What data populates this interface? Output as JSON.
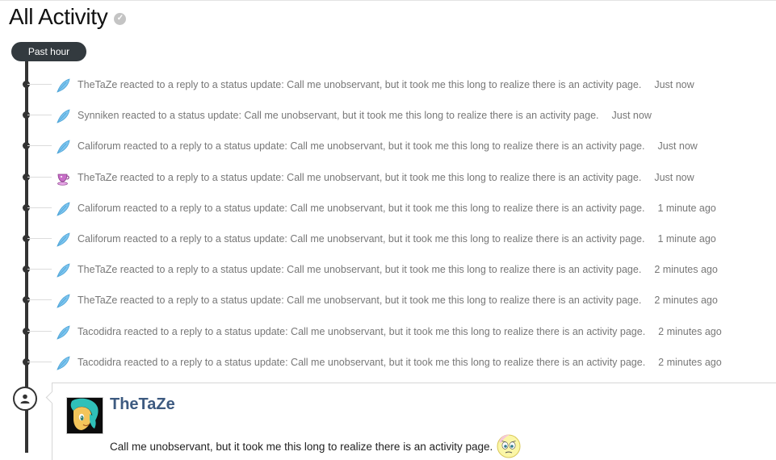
{
  "page": {
    "title": "All Activity"
  },
  "timeline": {
    "period_label": "Past hour"
  },
  "activities": [
    {
      "text": "TheTaZe reacted to a reply to a status update: Call me unobservant, but it took me this long to realize there is an activity page.",
      "time": "Just now",
      "reaction": "feather"
    },
    {
      "text": "Synniken reacted to a status update: Call me unobservant, but it took me this long to realize there is an activity page.",
      "time": "Just now",
      "reaction": "feather"
    },
    {
      "text": "Califorum reacted to a reply to a status update: Call me unobservant, but it took me this long to realize there is an activity page.",
      "time": "Just now",
      "reaction": "feather"
    },
    {
      "text": "TheTaZe reacted to a reply to a status update: Call me unobservant, but it took me this long to realize there is an activity page.",
      "time": "Just now",
      "reaction": "teacup"
    },
    {
      "text": "Califorum reacted to a reply to a status update: Call me unobservant, but it took me this long to realize there is an activity page.",
      "time": "1 minute ago",
      "reaction": "feather"
    },
    {
      "text": "Califorum reacted to a reply to a status update: Call me unobservant, but it took me this long to realize there is an activity page.",
      "time": "1 minute ago",
      "reaction": "feather"
    },
    {
      "text": "TheTaZe reacted to a reply to a status update: Call me unobservant, but it took me this long to realize there is an activity page.",
      "time": "2 minutes ago",
      "reaction": "feather"
    },
    {
      "text": "TheTaZe reacted to a reply to a status update: Call me unobservant, but it took me this long to realize there is an activity page.",
      "time": "2 minutes ago",
      "reaction": "feather"
    },
    {
      "text": "Tacodidra reacted to a reply to a status update: Call me unobservant, but it took me this long to realize there is an activity page.",
      "time": "2 minutes ago",
      "reaction": "feather"
    },
    {
      "text": "Tacodidra reacted to a reply to a status update: Call me unobservant, but it took me this long to realize there is an activity page.",
      "time": "2 minutes ago",
      "reaction": "feather"
    }
  ],
  "status_card": {
    "author": "TheTaZe",
    "text": "Call me unobservant, but it took me this long to realize there is an activity page."
  },
  "colors": {
    "timeline": "#333a3f",
    "author_link": "#3d5a80",
    "feather": "#7cc4ee"
  }
}
